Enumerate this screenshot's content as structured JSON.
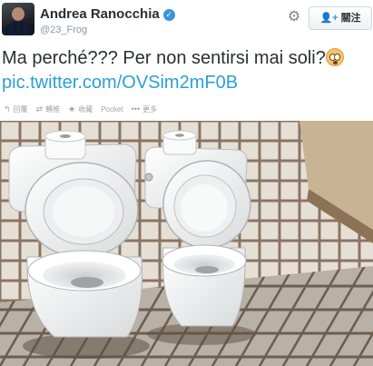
{
  "user": {
    "name": "Andrea Ranocchia",
    "handle": "@23_Frog",
    "verified_icon": "verified-badge-icon"
  },
  "header": {
    "settings_icon": "gear-icon",
    "follow_label": "關注",
    "follow_icon": "follow-plus-icon"
  },
  "tweet": {
    "text": "Ma perché??? Per non sentirsi mai soli?",
    "emoji": "flushed-face-emoji",
    "link": "pic.twitter.com/OVSim2mF0B"
  },
  "actions": [
    {
      "label": "回覆",
      "icon": "reply-icon"
    },
    {
      "label": "轉推",
      "icon": "retweet-icon"
    },
    {
      "label": "收藏",
      "icon": "star-icon"
    },
    {
      "label": "Pocket",
      "icon": "pocket-icon"
    },
    {
      "label": "更多",
      "icon": "more-icon"
    }
  ],
  "colors": {
    "link": "#2a9fd6",
    "verified": "#3b94d9",
    "muted": "#8899a6",
    "tile": "#e9e3dc",
    "grout": "#8a7562"
  }
}
